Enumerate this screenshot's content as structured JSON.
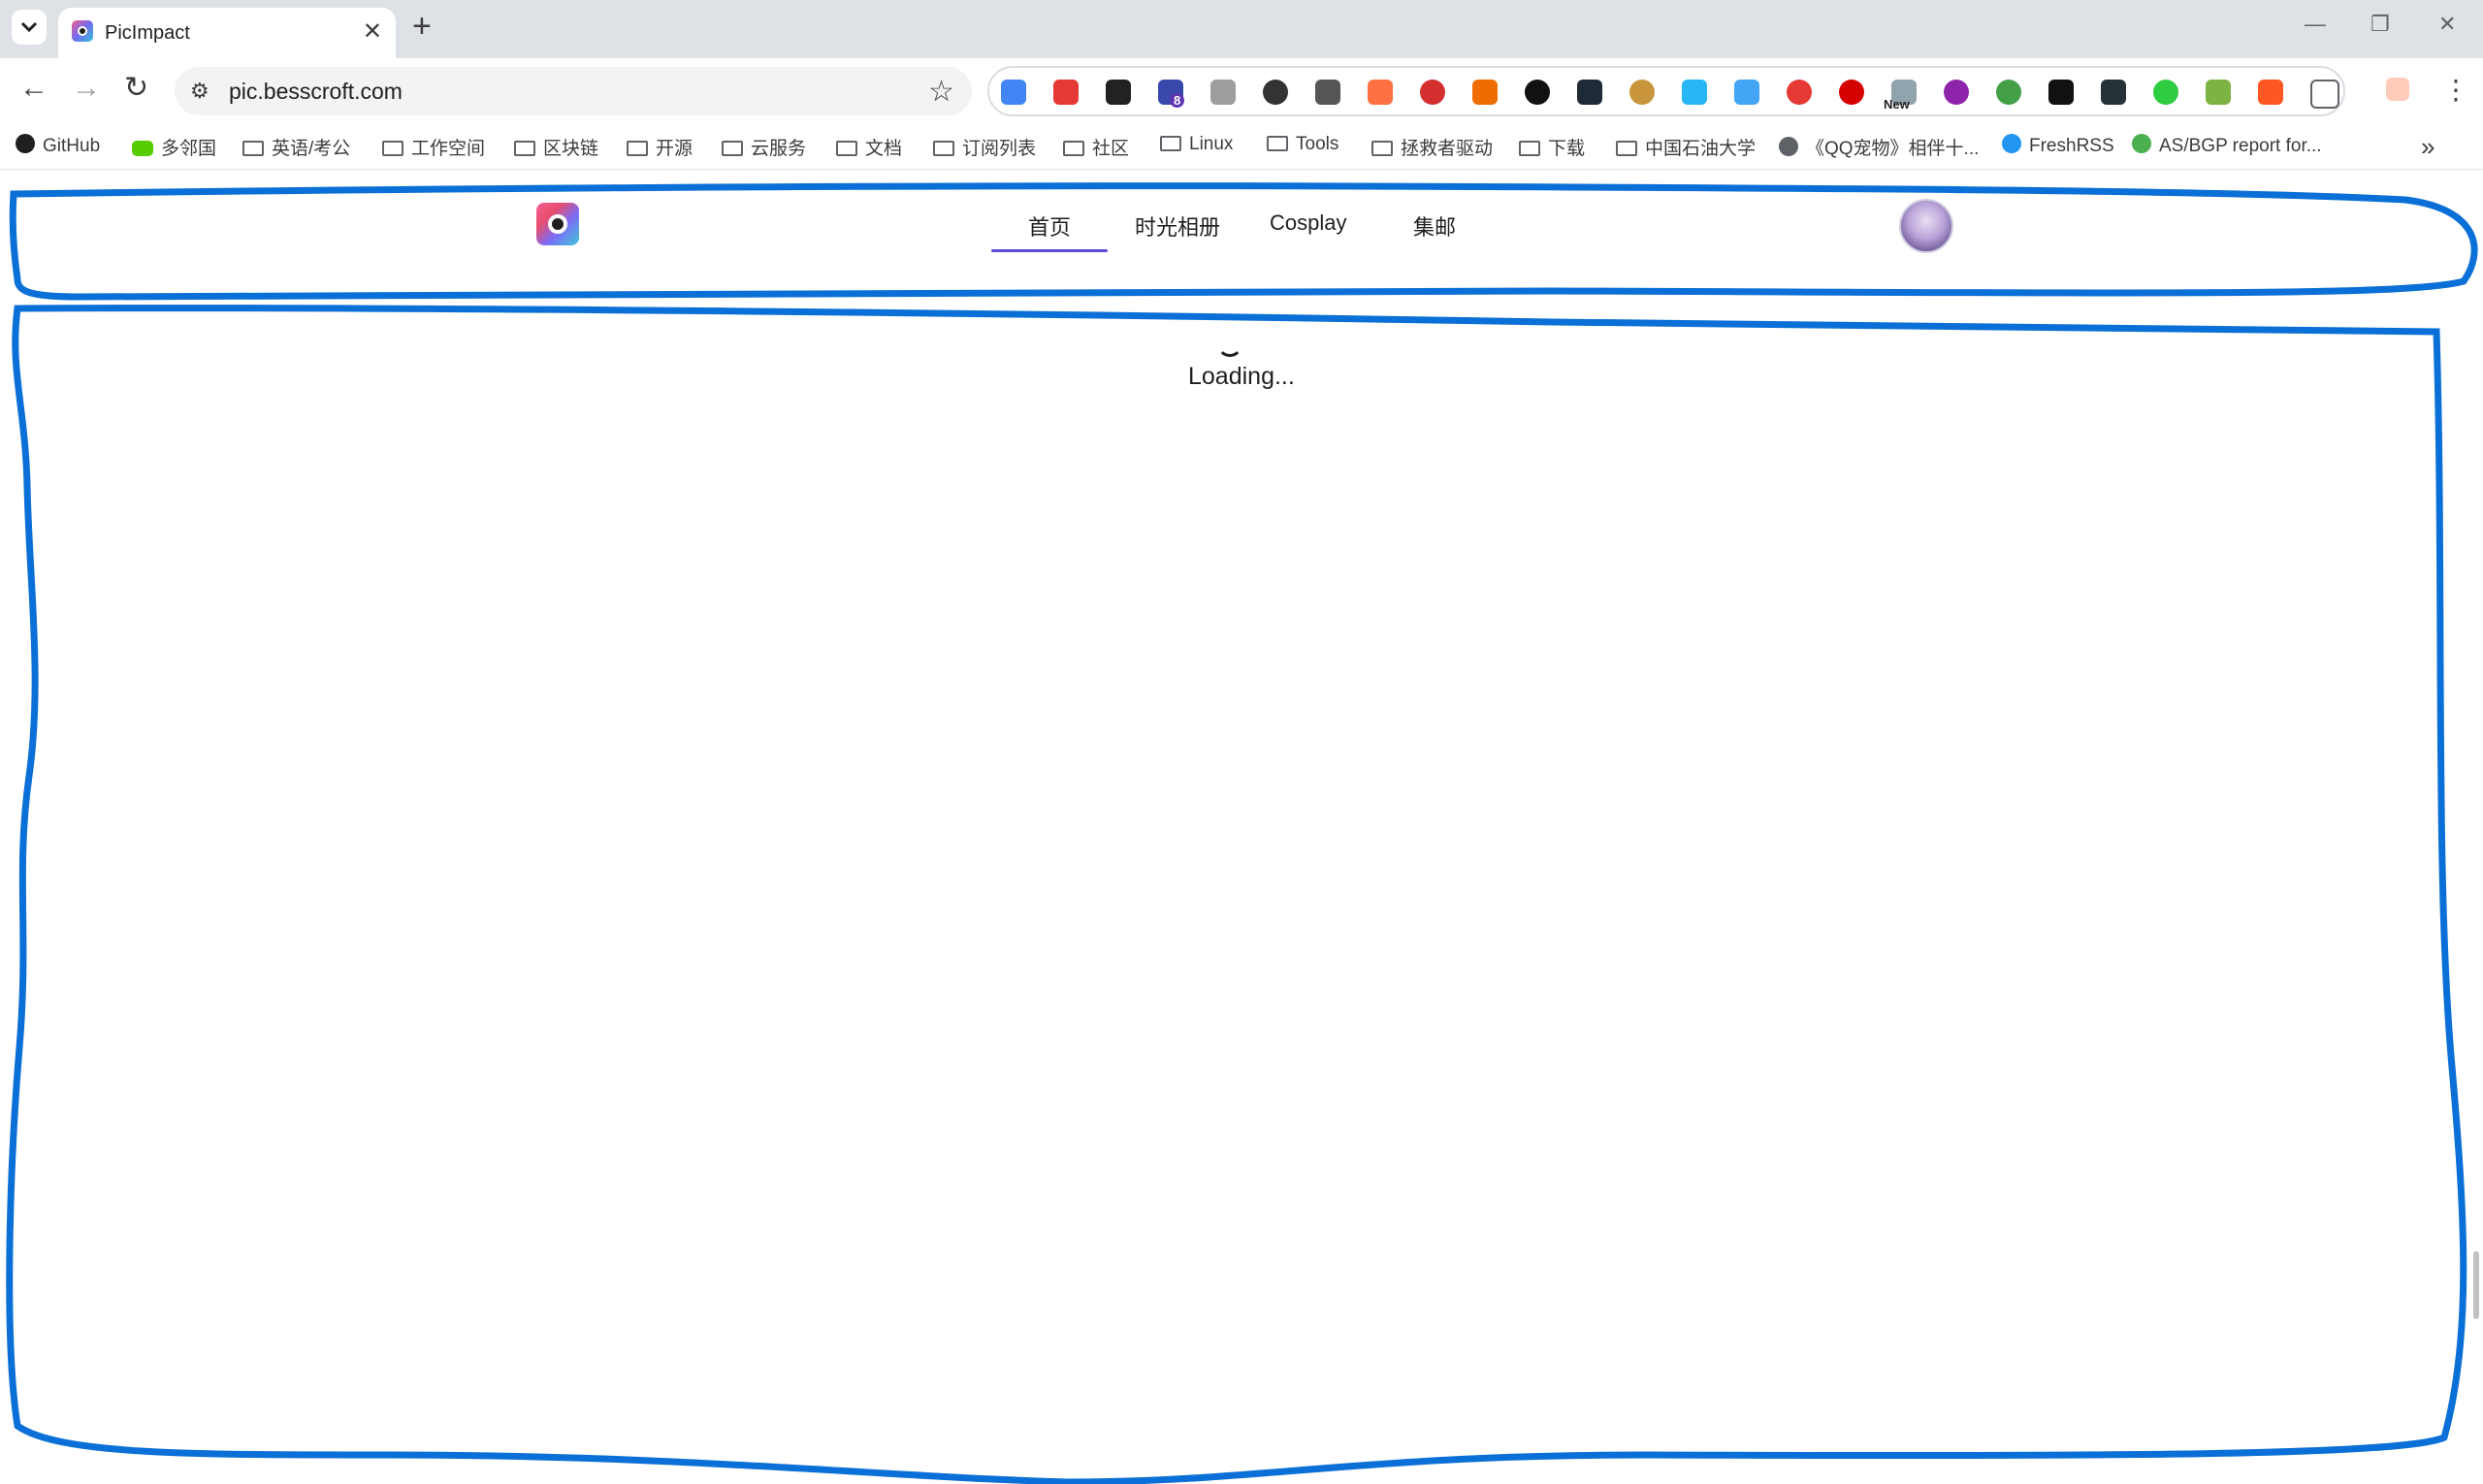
{
  "browser": {
    "tab_title": "PicImpact",
    "tab_close": "✕",
    "new_tab": "+",
    "window_controls": [
      "—",
      "❐",
      "✕"
    ],
    "url": "pic.besscroft.com",
    "extension_labels": {
      "badge": "8",
      "new": "New"
    },
    "bookmarks": [
      {
        "label": "GitHub",
        "icon": "github-icon"
      },
      {
        "label": "多邻国",
        "icon": "duolingo-icon"
      },
      {
        "label": "英语/考公",
        "icon": "folder-icon"
      },
      {
        "label": "工作空间",
        "icon": "folder-icon"
      },
      {
        "label": "区块链",
        "icon": "folder-icon"
      },
      {
        "label": "开源",
        "icon": "folder-icon"
      },
      {
        "label": "云服务",
        "icon": "folder-icon"
      },
      {
        "label": "文档",
        "icon": "folder-icon"
      },
      {
        "label": "订阅列表",
        "icon": "folder-icon"
      },
      {
        "label": "社区",
        "icon": "folder-icon"
      },
      {
        "label": "Linux",
        "icon": "folder-icon"
      },
      {
        "label": "Tools",
        "icon": "folder-icon"
      },
      {
        "label": "拯救者驱动",
        "icon": "folder-icon"
      },
      {
        "label": "下载",
        "icon": "folder-icon"
      },
      {
        "label": "中国石油大学",
        "icon": "folder-icon"
      },
      {
        "label": "《QQ宠物》相伴十...",
        "icon": "globe-icon"
      },
      {
        "label": "FreshRSS",
        "icon": "freshrss-icon"
      },
      {
        "label": "AS/BGP report for...",
        "icon": "bgp-icon"
      }
    ],
    "bookmarks_more": "»"
  },
  "site": {
    "nav": [
      {
        "label": "首页",
        "active": true
      },
      {
        "label": "时光相册",
        "active": false
      },
      {
        "label": "Cosplay",
        "active": false
      },
      {
        "label": "集邮",
        "active": false
      }
    ],
    "loading_text": "Loading..."
  },
  "colors": {
    "annotation": "#0a6fd6",
    "nav_active": "#5b4cdb",
    "tabstrip": "#dee1e6"
  }
}
